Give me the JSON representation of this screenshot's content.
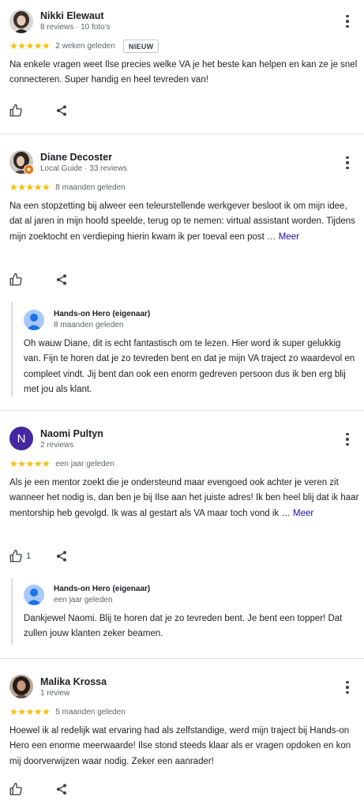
{
  "reviews": [
    {
      "name": "Nikki Elewaut",
      "meta": "8 reviews · 10 foto's",
      "stars": "★★★★★",
      "date": "2 weken geleden",
      "badge": "NIEUW",
      "text": "Na enkele vragen weet Ilse precies welke VA je het beste kan helpen en kan ze je snel connecteren. Super handig en heel tevreden van!"
    },
    {
      "name": "Diane Decoster",
      "meta": "Local Guide · 33 reviews",
      "stars": "★★★★★",
      "date": "8 maanden geleden",
      "text": "Na een stopzetting bij alweer een teleurstellende werkgever besloot ik om mijn idee, dat al jaren in mijn hoofd speelde, terug op te nemen: virtual assistant worden. Tijdens mijn zoektocht en verdieping hierin kwam ik per toeval een post …",
      "more": "Meer",
      "reply": {
        "name": "Hands-on Hero (eigenaar)",
        "date": "8 maanden geleden",
        "text": "Oh wauw Diane, dit is echt fantastisch om te lezen. Hier word ik super gelukkig van. Fijn te horen dat je zo tevreden bent en dat je mijn VA traject zo waardevol en compleet vindt. Jij bent dan ook een enorm gedreven persoon dus ik ben erg blij met jou als klant."
      }
    },
    {
      "name": "Naomi Pultyn",
      "initial": "N",
      "meta": "2 reviews",
      "stars": "★★★★★",
      "date": "een jaar geleden",
      "text": "Als je een mentor zoekt die je ondersteund maar evengoed ook achter je veren zit wanneer het nodig is, dan ben je bij Ilse aan het juiste adres! Ik ben heel blij dat ik haar mentorship heb gevolgd. Ik was al gestart als VA maar toch vond ik …",
      "more": "Meer",
      "likes": "1",
      "reply": {
        "name": "Hands-on Hero (eigenaar)",
        "date": "een jaar geleden",
        "text": "Dankjewel Naomi. Blij te horen dat je zo tevreden bent. Je bent een topper! Dat zullen jouw klanten zeker beamen."
      }
    },
    {
      "name": "Malika Krossa",
      "meta": "1 review",
      "stars": "★★★★★",
      "date": "5 maanden geleden",
      "text": "Hoewel ik al redelijk wat ervaring had als zelfstandige, werd mijn traject bij Hands-on Hero een enorme meerwaarde! Ilse stond steeds klaar als er vragen opdoken en kon mij doorverwijzen waar nodig. Zeker een aanrader!"
    }
  ],
  "colors": {
    "star": "#fbbc04",
    "link": "#1a0dab",
    "naomi_avatar": "#4527a0",
    "owner_avatar": "#a8c7fa"
  },
  "icons": [
    "thumbs-up-icon",
    "share-icon",
    "more-vert-icon",
    "local-guide-badge-icon",
    "person-icon"
  ]
}
